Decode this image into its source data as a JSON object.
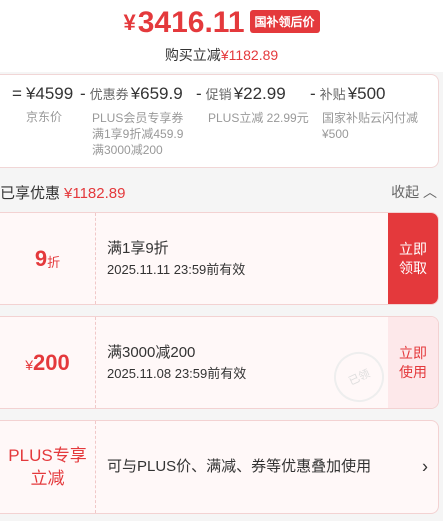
{
  "header": {
    "currency": "¥",
    "final_price": "3416.11",
    "price_tag": "国补领后价",
    "instant_label": "购买立减",
    "instant_amount": "¥1182.89"
  },
  "breakdown": [
    {
      "operator": "=",
      "label": "",
      "amount": "¥4599",
      "note": "京东价"
    },
    {
      "operator": "-",
      "label": "优惠券",
      "amount": "¥659.9",
      "note": "PLUS会员专享券\n满1享9折减459.9\n满3000减200"
    },
    {
      "operator": "-",
      "label": "促销",
      "amount": "¥22.99",
      "note": "PLUS立减 22.99元"
    },
    {
      "operator": "-",
      "label": "补贴",
      "amount": "¥500",
      "note": "国家补贴云闪付减\n¥500"
    }
  ],
  "savings": {
    "label": "已享优惠",
    "amount": "¥1182.89",
    "collapse": "收起"
  },
  "coupons": [
    {
      "discount": "9",
      "discount_unit": "折",
      "title": "满1享9折",
      "date": "2025.11.11 23:59前有效",
      "button": "立即\n领取",
      "state": "active"
    },
    {
      "discount_sym": "¥",
      "discount": "200",
      "title": "满3000减200",
      "date": "2025.11.08 23:59前有效",
      "button": "立即\n使用",
      "state": "used",
      "stamp": "已领"
    }
  ],
  "plus_card": {
    "label": "PLUS专享\n立减",
    "text": "可与PLUS价、满减、券等优惠叠加使用"
  },
  "colors": {
    "accent": "#e4393c",
    "light_bg": "#fff8f8"
  }
}
